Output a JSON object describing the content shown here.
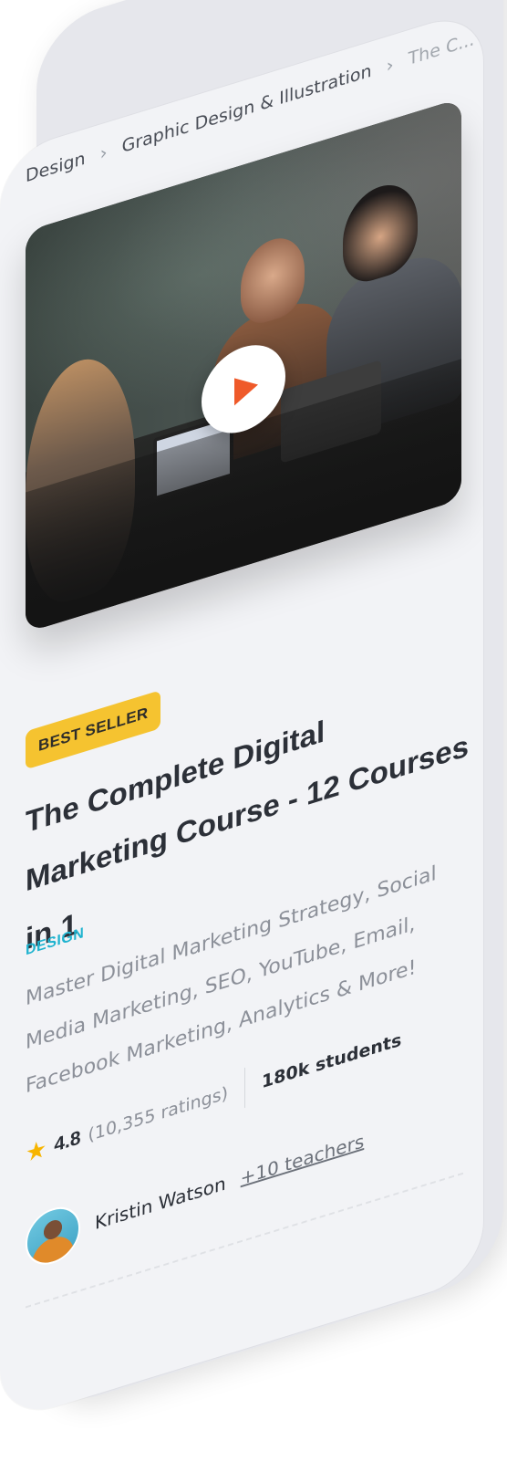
{
  "breadcrumb": {
    "items": [
      "Design",
      "Graphic Design & Illustration",
      "The C..."
    ]
  },
  "video": {
    "play_icon": "play-icon",
    "play_color": "#ef5a2a"
  },
  "course": {
    "badge": "BEST SELLER",
    "badge_color": "#f5c330",
    "title": "The Complete Digital Marketing Course - 12 Courses in 1",
    "category": "DESIGN",
    "category_color": "#1fb3cf",
    "description": "Master Digital Marketing Strategy, Social Media Marketing, SEO, YouTube, Email, Facebook Marketing, Analytics & More!",
    "rating": "4.8",
    "ratings_count": "(10,355 ratings)",
    "students": "180k students",
    "star_icon": "star-icon",
    "star_color": "#f7b500"
  },
  "author": {
    "name": "Kristin Watson",
    "more_teachers": "+10 teachers"
  }
}
